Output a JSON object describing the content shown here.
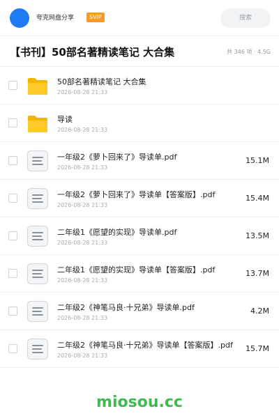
{
  "header": {
    "user_name": "夸克网盘分享",
    "badge": "SVIP",
    "search_label": "搜索"
  },
  "title_bar": {
    "title": "【书刊】50部名著精读笔记 大合集",
    "meta": "共 346 项 · 4.5G"
  },
  "colors": {
    "accent": "#1e7bf5",
    "badge": "#f79a2c",
    "folder": "#fbc02d",
    "watermark": "#3fb950"
  },
  "files": [
    {
      "type": "folder",
      "icon": "folder-icon",
      "name": "50部名著精读笔记  大合集",
      "date": "2026-08-28 21:33",
      "size": ""
    },
    {
      "type": "folder",
      "icon": "folder-icon",
      "name": "导读",
      "date": "2026-08-28 21:33",
      "size": ""
    },
    {
      "type": "pdf",
      "icon": "document-icon",
      "name": "一年级2《萝卜回来了》导读单.pdf",
      "date": "2026-08-28 21:33",
      "size": "15.1M"
    },
    {
      "type": "pdf",
      "icon": "document-icon",
      "name": "一年级2《萝卜回来了》导读单【答案版】.pdf",
      "date": "2026-08-28 21:33",
      "size": "15.4M"
    },
    {
      "type": "pdf",
      "icon": "document-icon",
      "name": "二年级1《愿望的实现》导读单.pdf",
      "date": "2026-08-28 21:33",
      "size": "13.5M"
    },
    {
      "type": "pdf",
      "icon": "document-icon",
      "name": "二年级1《愿望的实现》导读单【答案版】.pdf",
      "date": "2026-08-28 21:33",
      "size": "13.7M"
    },
    {
      "type": "pdf",
      "icon": "document-icon",
      "name": "二年级2《神笔马良·十兄弟》导读单.pdf",
      "date": "2026-08-28 21:33",
      "size": "4.2M"
    },
    {
      "type": "pdf",
      "icon": "document-icon",
      "name": "二年级2《神笔马良·十兄弟》导读单【答案版】.pdf",
      "date": "2026-08-28 21:33",
      "size": "15.7M"
    }
  ],
  "watermark": "miosou.cc"
}
